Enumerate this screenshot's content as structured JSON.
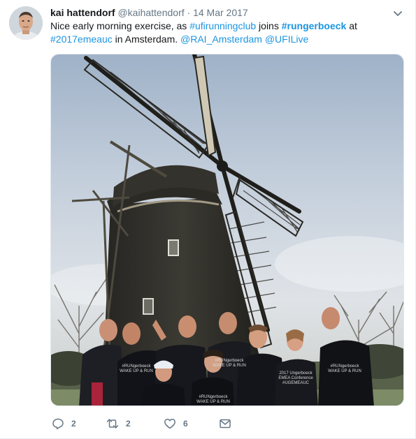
{
  "tweet": {
    "fullname": "kai hattendorf",
    "username": "@kaihattendorf",
    "separator": "·",
    "timestamp": "14 Mar 2017",
    "text": {
      "t1": "Nice early morning exercise, as ",
      "tag1": "#ufirunningclub",
      "t2": " joins ",
      "tag2": "#rungerboeck",
      "t3": " at",
      "tag3": "#2017emeauc",
      "t4": " in Amsterdam. ",
      "mention1": "@RAI_Amsterdam",
      "t5": " ",
      "mention2": "@UFILive"
    },
    "shirt_text": [
      "#RUNgerboeck",
      "WAKE UP & RUN",
      "2017 Ungerboeck",
      "EMEA Conference",
      "#UGEMEAUC"
    ],
    "actions": {
      "reply_count": "2",
      "retweet_count": "2",
      "like_count": "6"
    }
  },
  "icons": {
    "reply": "reply-icon",
    "retweet": "retweet-icon",
    "like": "heart-icon",
    "dm": "envelope-icon",
    "caret": "chevron-down-icon"
  },
  "colors": {
    "link": "#1b95e0",
    "muted": "#657786",
    "text": "#14171a"
  }
}
